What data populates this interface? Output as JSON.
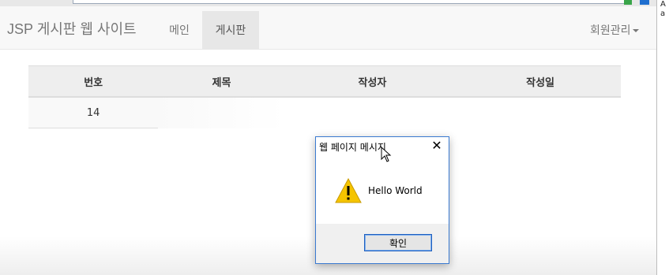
{
  "navbar": {
    "brand": "JSP 게시판 웹 사이트",
    "items": [
      {
        "label": "메인"
      },
      {
        "label": "게시판",
        "active": true
      }
    ],
    "member_menu": {
      "label": "회원관리"
    }
  },
  "board": {
    "headers": [
      "번호",
      "제목",
      "작성자",
      "작성일"
    ],
    "rows": [
      {
        "num": "14",
        "title": "",
        "author": "",
        "date": ""
      }
    ]
  },
  "dialog": {
    "title": "웹 페이지 메시지",
    "message": "Hello World",
    "ok_label": "확인",
    "icon": "warning-icon"
  },
  "side_panel": {
    "lines": [
      "A",
      "a"
    ]
  },
  "colors": {
    "navbar_bg": "#f8f8f8",
    "active_tab_bg": "#e7e7e7",
    "dialog_border": "#3a7ad1",
    "warning_yellow": "#f5c400"
  }
}
